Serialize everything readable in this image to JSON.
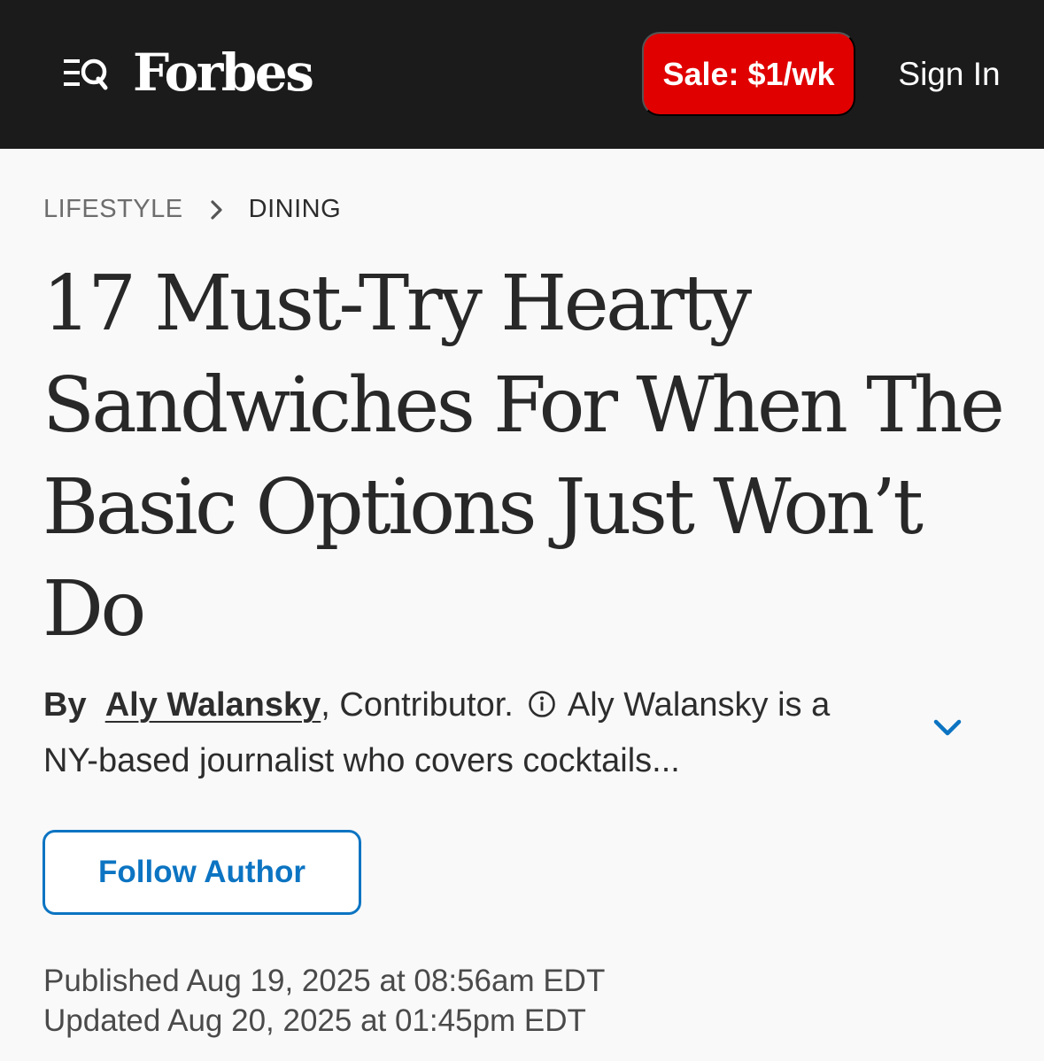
{
  "header": {
    "brand": "Forbes",
    "sale_label": "Sale: $1/wk",
    "signin_label": "Sign In",
    "menu_icon": "menu-search-icon",
    "colors": {
      "bar": "#1b1b1b",
      "sale": "#e00000"
    }
  },
  "breadcrumb": {
    "items": [
      "LIFESTYLE",
      "DINING"
    ],
    "separator_icon": "chevron-right-icon"
  },
  "article": {
    "headline_lines": [
      "17 Must-Try Hearty",
      "Sandwiches For When The",
      "Basic Options Just Won’t",
      "Do"
    ],
    "byline": {
      "by": "By",
      "author": "Aly Walansky",
      "comma": ",",
      "role": " Contributor. ",
      "info_icon": "info-icon",
      "bio": " Aly Walansky is a NY-based journalist who covers cocktails...",
      "expand_icon": "chevron-down-icon"
    },
    "follow_label": "Follow Author",
    "published": "Published Aug 19, 2025 at 08:56am EDT",
    "updated": "Updated Aug 20, 2025 at 01:45pm EDT",
    "accent_color": "#0c74c2"
  }
}
